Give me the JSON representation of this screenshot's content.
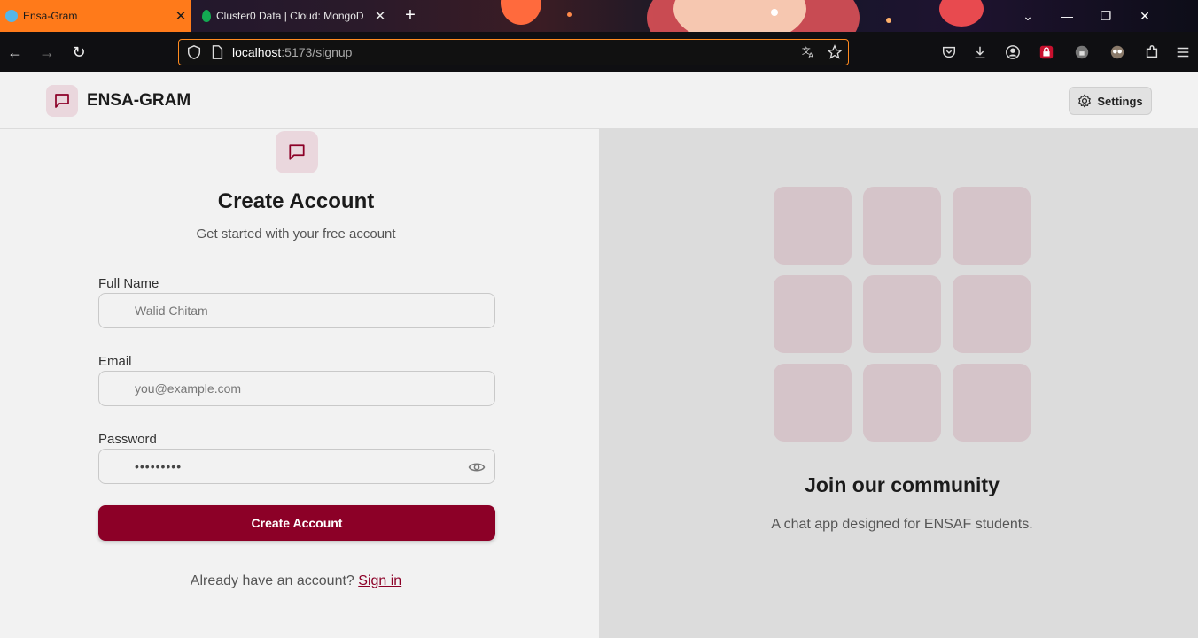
{
  "browser": {
    "tabs": [
      {
        "title": "Ensa-Gram",
        "active": true
      },
      {
        "title": "Cluster0 Data | Cloud: MongoD",
        "active": false
      }
    ],
    "url_host": "localhost",
    "url_path": ":5173/signup",
    "accent_color": "#ff7a1a"
  },
  "header": {
    "brand": "ENSA-GRAM",
    "settings_label": "Settings"
  },
  "signup": {
    "title": "Create Account",
    "subtitle": "Get started with your free account",
    "full_name_label": "Full Name",
    "full_name_placeholder": "Walid Chitam",
    "email_label": "Email",
    "email_placeholder": "you@example.com",
    "password_label": "Password",
    "password_value": "•••••••••",
    "submit_label": "Create Account",
    "signin_prompt": "Already have an account? ",
    "signin_link": "Sign in",
    "brand_color": "#8c0027"
  },
  "community": {
    "title": "Join our community",
    "description": "A chat app designed for ENSAF students.",
    "tile_count": 9
  }
}
